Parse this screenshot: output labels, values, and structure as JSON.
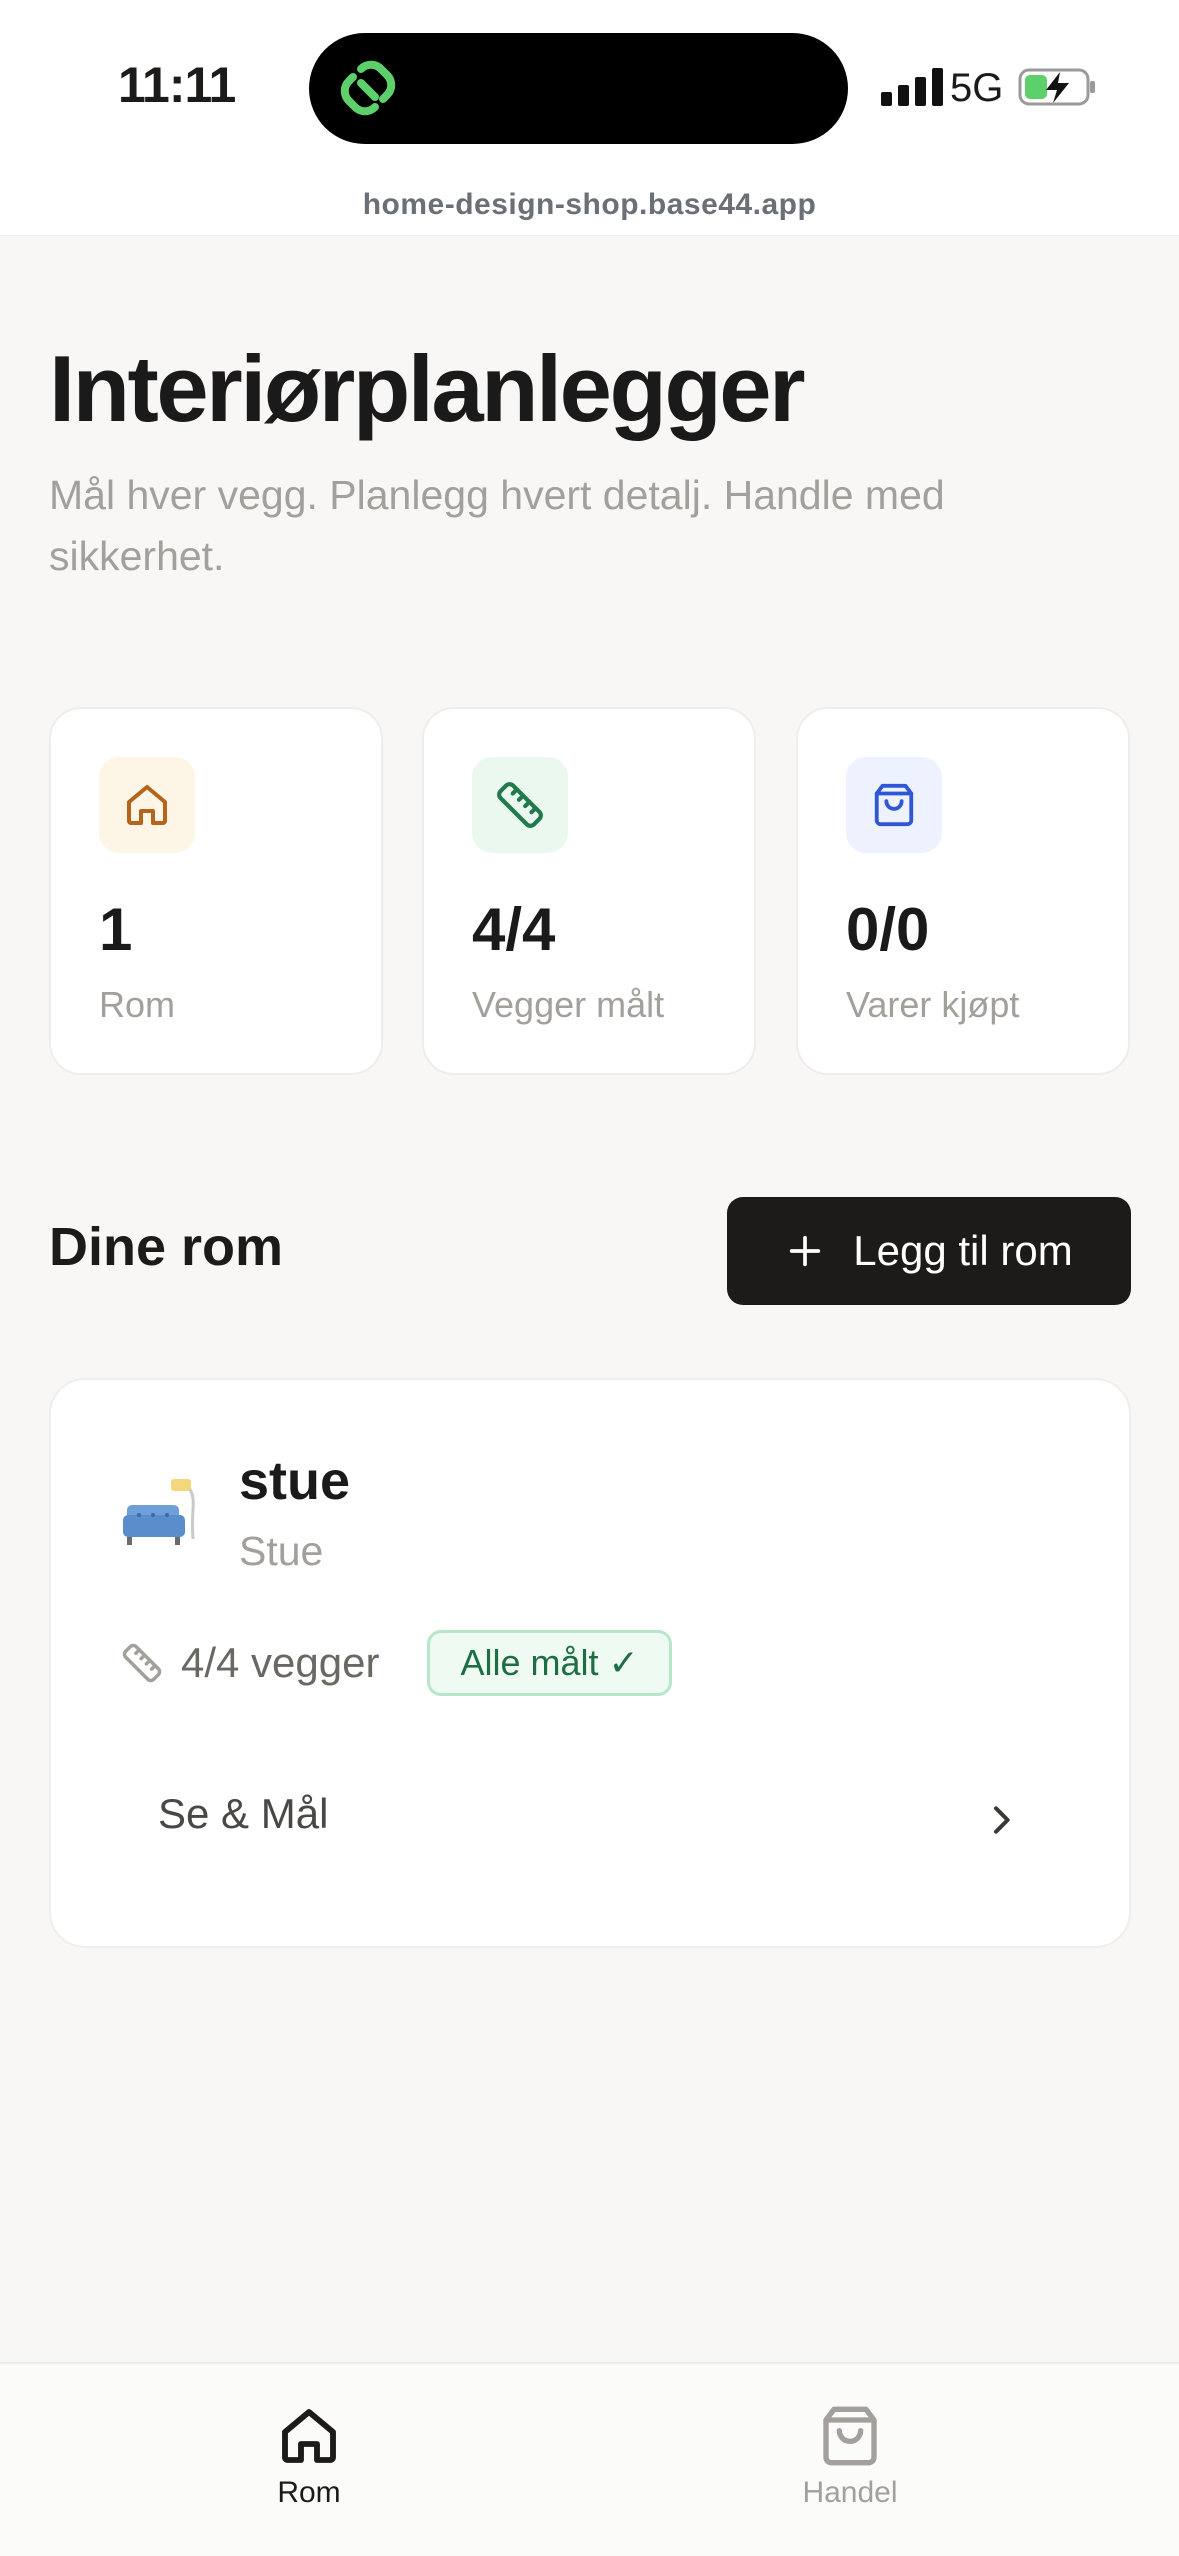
{
  "status_bar": {
    "time": "11:11",
    "network": "5G"
  },
  "browser": {
    "url": "home-design-shop.base44.app"
  },
  "header": {
    "title": "Interiørplanlegger",
    "subtitle": "Mål hver vegg. Planlegg hvert detalj. Handle med sikkerhet."
  },
  "stats": [
    {
      "value": "1",
      "label": "Rom",
      "icon": "house-icon",
      "bg": "#fdf6e7",
      "color": "#b5641a"
    },
    {
      "value": "4/4",
      "label": "Vegger målt",
      "icon": "ruler-icon",
      "bg": "#ebf8f0",
      "color": "#207a4b"
    },
    {
      "value": "0/0",
      "label": "Varer kjøpt",
      "icon": "shopping-bag-icon",
      "bg": "#edf2fe",
      "color": "#2f56d6"
    }
  ],
  "rooms_section": {
    "title": "Dine rom",
    "add_button_label": "Legg til rom"
  },
  "rooms": [
    {
      "name": "stue",
      "type": "Stue",
      "walls_text": "4/4 vegger",
      "badge": "Alle målt ✓",
      "link_label": "Se & Mål",
      "icon": "sofa-emoji"
    }
  ],
  "tab_bar": {
    "tabs": [
      {
        "label": "Rom",
        "icon": "house-icon",
        "active": true
      },
      {
        "label": "Handel",
        "icon": "shopping-bag-icon",
        "active": false
      }
    ]
  }
}
